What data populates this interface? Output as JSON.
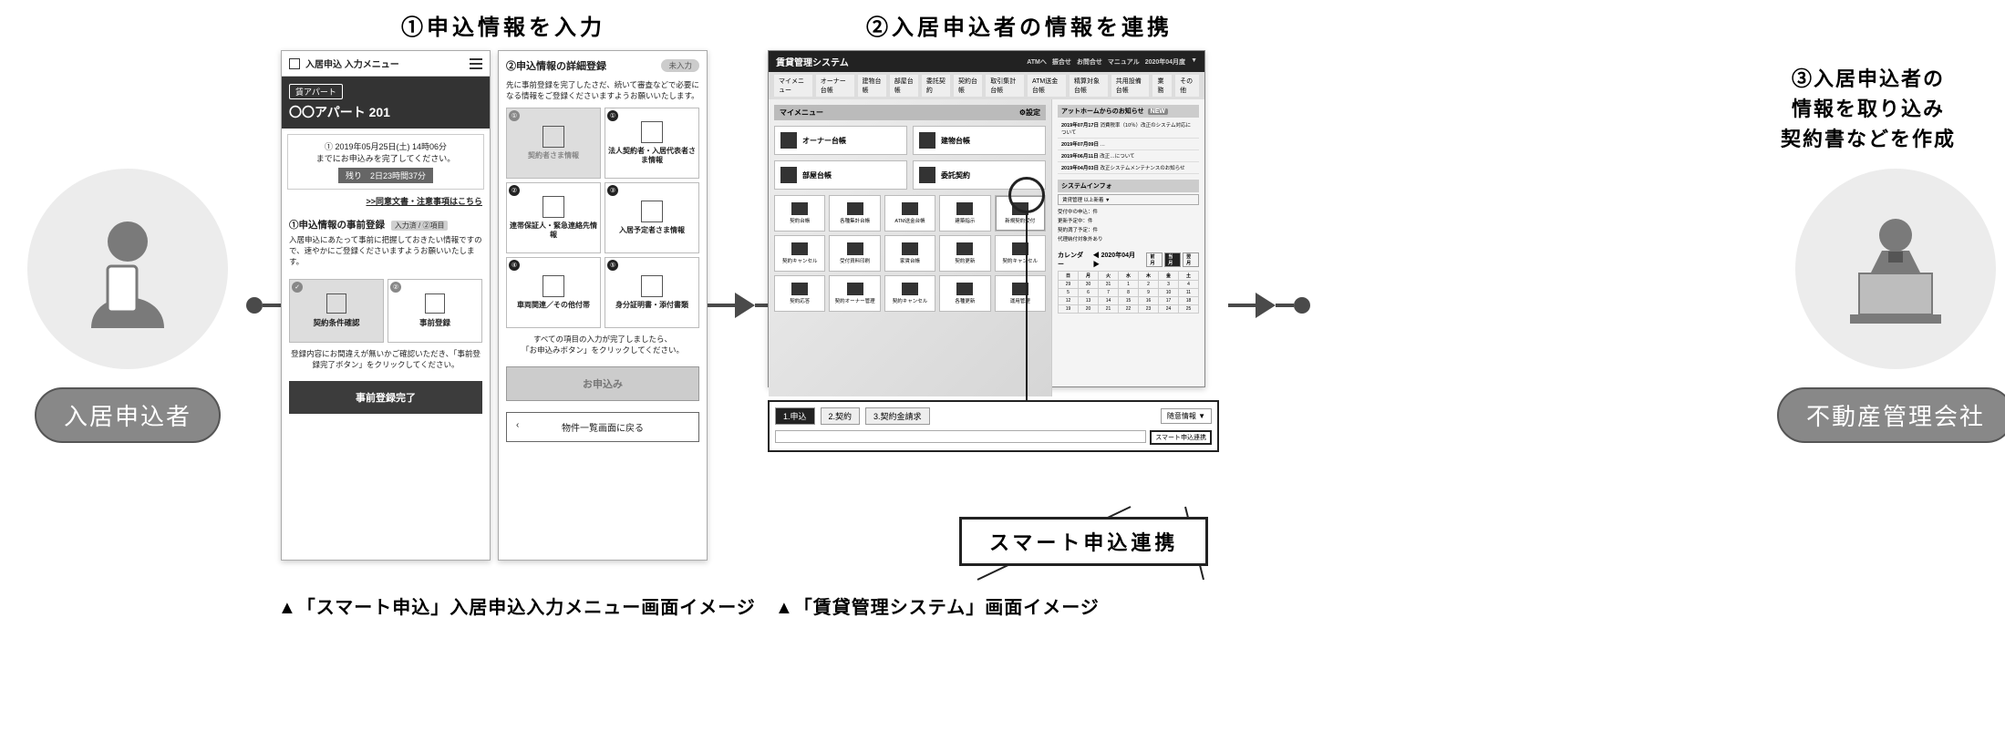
{
  "steps": {
    "s1": "①申込情報を入力",
    "s2": "②入居申込者の情報を連携",
    "s3_line1": "③入居申込者の",
    "s3_line2": "情報を取り込み",
    "s3_line3": "契約書などを作成"
  },
  "actors": {
    "left": "入居申込者",
    "right": "不動産管理会社"
  },
  "captions": {
    "left": "▲「スマート申込」入居申込入力メニュー画面イメージ",
    "right": "▲「賃貸管理システム」画面イメージ"
  },
  "mobile1": {
    "header": "入居申込 入力メニュー",
    "tag": "賃アパート",
    "property": "〇〇アパート 201",
    "deadline_line1": "① 2019年05月25日(土) 14時06分",
    "deadline_line2": "までにお申込みを完了してください。",
    "countdown": "残り　2日23時間37分",
    "consent_link": ">>同意文書・注意事項はこちら",
    "sec1_title": "①申込情報の事前登録",
    "sec1_badge": "入力済 / ②項目",
    "sec1_note": "入居申込にあたって事前に把握しておきたい情報ですので、速やかにご登録くださいますようお願いいたします。",
    "tile1": "契約条件確認",
    "tile2": "事前登録",
    "confirm_note": "登録内容にお間違えが無いかご確認いただき、「事前登録完了ボタン」をクリックしてください。",
    "btn_primary": "事前登録完了"
  },
  "mobile2": {
    "sec2_title": "②申込情報の詳細登録",
    "sec2_badge": "未入力",
    "lead": "先に事前登録を完了したさだ、続いて審査などで必要になる情報をご登録くださいますようお願いいたします。",
    "tiles": [
      "契約者さま情報",
      "法人契約者・入居代表者さま情報",
      "連帯保証人・緊急連絡先情報",
      "入居予定者さま情報",
      "車両関連／その他付帯",
      "身分証明書・添付書類"
    ],
    "done_note1": "すべての項目の入力が完了しましたら、",
    "done_note2": "「お申込みボタン」をクリックしてください。",
    "btn_apply": "お申込み",
    "btn_back": "物件一覧画面に戻る"
  },
  "desktop": {
    "title": "賃貸管理システム",
    "toolbar": [
      "ATMへ",
      "振合せ",
      "お問合せ",
      "マニュアル",
      "2020年04月度",
      "▼"
    ],
    "tabs": [
      "マイメニュー",
      "オーナー台帳",
      "建物台帳",
      "部屋台帳",
      "委託契約",
      "契約台帳",
      "取引集計台帳",
      "ATM送金台帳",
      "精算対象台帳",
      "共用設備台帳",
      "業務",
      "その他"
    ],
    "mymenu": "マイメニュー",
    "settings": "設定",
    "bigcards": [
      "オーナー台帳",
      "建物台帳",
      "部屋台帳",
      "委託契約"
    ],
    "iconcardsRow1": [
      "契約台帳",
      "各種集計台帳",
      "ATM送金台帳",
      "建築指示",
      "新規契約受付"
    ],
    "iconcardsRow2": [
      "契約キャンセル",
      "受付資料印刷",
      "家賃台帳",
      "契約更新",
      "契約キャンセル"
    ],
    "iconcardsRow3": [
      "契約応答",
      "契約オーナー管理",
      "契約キャンセル",
      "各種更新",
      "運用管理"
    ],
    "newsHeader": "アットホームからのお知らせ",
    "newsBadge": "NEW",
    "newsItems": [
      {
        "date": "2019年07月17日",
        "txt": "消費税率（10％）改正のシステム対応について"
      },
      {
        "date": "2019年07月09日",
        "txt": "…"
      },
      {
        "date": "2019年06月11日",
        "txt": "改正…について"
      },
      {
        "date": "2019年04月03日",
        "txt": "改正システムメンテナンスのお知らせ"
      }
    ],
    "sysInfoHeader": "システムインフォ",
    "sysInfoSelect": "賃貸管理 以上新着 ▼",
    "sysInfoLines": [
      "受付中の申込：件",
      "更新予定中：件",
      "契約満了予定：件",
      "代理納付対象外あり"
    ],
    "calHeader": "カレンダー",
    "calMonth": "◀ 2020年04月 ▶",
    "calBtns": [
      "前月",
      "当月",
      "翌月"
    ],
    "calDow": [
      "日",
      "月",
      "火",
      "水",
      "木",
      "金",
      "土"
    ],
    "calWeeks": [
      [
        "29",
        "30",
        "31",
        "1",
        "2",
        "3",
        "4"
      ],
      [
        "5",
        "6",
        "7",
        "8",
        "9",
        "10",
        "11"
      ],
      [
        "12",
        "13",
        "14",
        "15",
        "16",
        "17",
        "18"
      ],
      [
        "19",
        "20",
        "21",
        "22",
        "23",
        "24",
        "25"
      ]
    ],
    "barTabs": [
      "1.申込",
      "2.契約",
      "3.契約金請求"
    ],
    "barRight": "随意情報 ▼",
    "barLinkBtn": "スマート申込連携",
    "zoom": "スマート申込連携"
  }
}
